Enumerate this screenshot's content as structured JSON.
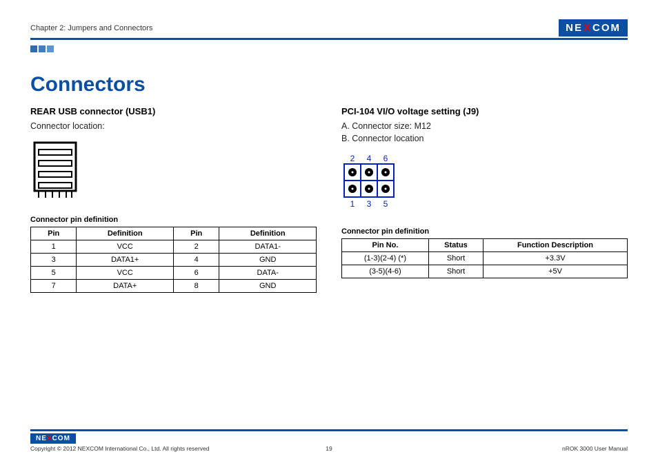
{
  "header": {
    "chapter": "Chapter 2: Jumpers and Connectors",
    "logo_pre": "NE",
    "logo_x": "X",
    "logo_post": "COM"
  },
  "title": "Connectors",
  "left": {
    "heading": "REAR USB connector (USB1)",
    "loc_label": "Connector location:",
    "table_label": "Connector pin definition",
    "th_pin": "Pin",
    "th_def": "Definition",
    "rows": [
      {
        "p1": "1",
        "d1": "VCC",
        "p2": "2",
        "d2": "DATA1-"
      },
      {
        "p1": "3",
        "d1": "DATA1+",
        "p2": "4",
        "d2": "GND"
      },
      {
        "p1": "5",
        "d1": "VCC",
        "p2": "6",
        "d2": "DATA-"
      },
      {
        "p1": "7",
        "d1": "DATA+",
        "p2": "8",
        "d2": "GND"
      }
    ]
  },
  "right": {
    "heading": "PCI-104 VI/O voltage setting (J9)",
    "line_a": "A. Connector size: M12",
    "line_b": "B. Connector location",
    "pins_top": {
      "a": "2",
      "b": "4",
      "c": "6"
    },
    "pins_bottom": {
      "a": "1",
      "b": "3",
      "c": "5"
    },
    "table_label": "Connector pin definition",
    "th_pin": "Pin No.",
    "th_status": "Status",
    "th_func": "Function Description",
    "rows": [
      {
        "pin": "(1-3)(2-4)  (*)",
        "status": "Short",
        "func": "+3.3V"
      },
      {
        "pin": "(3-5)(4-6)",
        "status": "Short",
        "func": "+5V"
      }
    ]
  },
  "footer": {
    "logo_pre": "NE",
    "logo_x": "X",
    "logo_post": "COM",
    "copyright": "Copyright © 2012 NEXCOM International Co., Ltd. All rights reserved",
    "page_no": "19",
    "manual": "nROK 3000 User Manual"
  }
}
